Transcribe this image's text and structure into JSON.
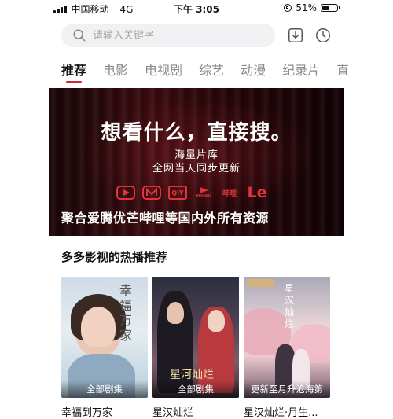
{
  "status_bar": {
    "carrier": "中国移动",
    "network": "4G",
    "time": "下午 3:05",
    "battery": "51%",
    "battery_level": 0.51
  },
  "search": {
    "placeholder": "请输入关键字"
  },
  "tabs": [
    "推荐",
    "电影",
    "电视剧",
    "综艺",
    "动漫",
    "纪录片",
    "直"
  ],
  "banner": {
    "headline": "想看什么，直接搜。",
    "sub_line1": "海量片库",
    "sub_line2": "全网当天同步更新",
    "tagline": "聚合爱腾优芒哔哩等国内外所有资源",
    "logos": [
      "tencent-video-logo",
      "mgtv-logo",
      "iqiyi-logo",
      "youku-logo",
      "bilibili-logo",
      "le-logo"
    ],
    "logo_text": {
      "iqiyi": "QIY",
      "youku": "YOUKU",
      "bilibili": "哔哩",
      "le": "Le"
    }
  },
  "section": {
    "title": "多多影视的热播推荐"
  },
  "cards": [
    {
      "poster_label": "全部剧集",
      "title": "幸福到万家",
      "poster_text": "幸福万家"
    },
    {
      "poster_label": "全部剧集",
      "title": "星汉灿烂",
      "poster_text": "星河灿烂"
    },
    {
      "poster_label": "更新至月升沧海第",
      "title": "星汉灿烂·月生...",
      "poster_text": "星汉灿烂"
    }
  ],
  "colors": {
    "accent": "#d9262b",
    "tab_inactive": "#8a8a8a",
    "search_bg": "#f1f1f3"
  }
}
